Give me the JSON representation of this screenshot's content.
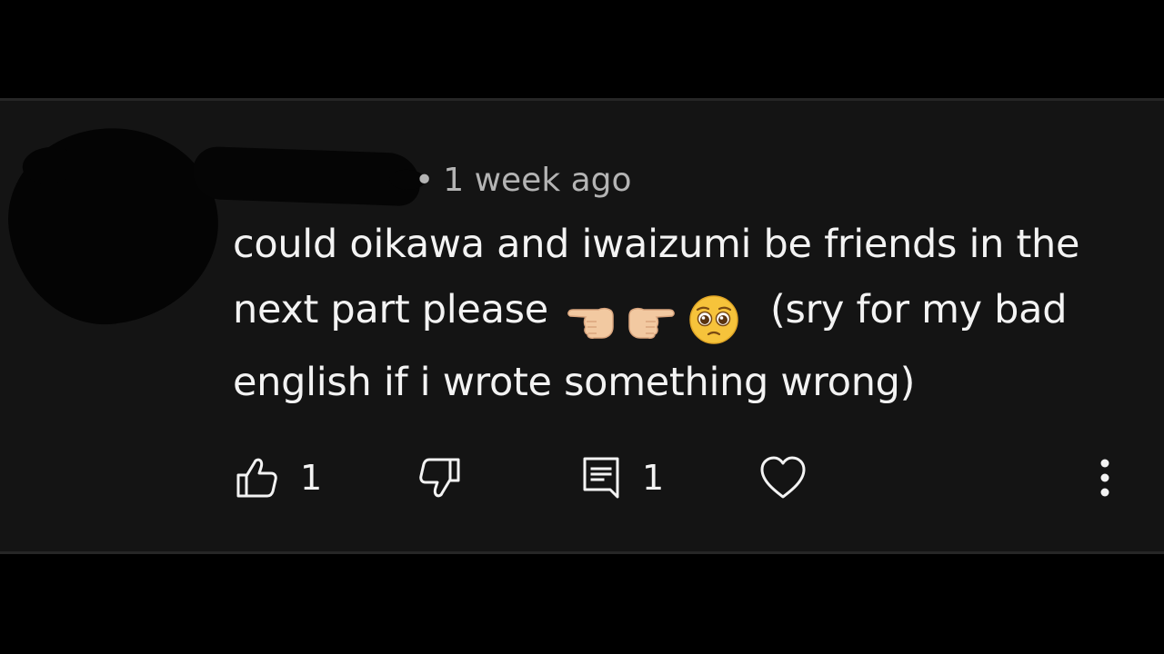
{
  "comment": {
    "timestamp": "1 week ago",
    "separator": "•",
    "text_before_emoji": "could oikawa and iwaizumi be friends in the next part please",
    "emoji": [
      "backhand-index-pointing-left",
      "backhand-index-pointing-right",
      "pleading-face"
    ],
    "text_after_emoji": "(sry for my bad english if i wrote something wrong)"
  },
  "actions": {
    "like_count": "1",
    "reply_count": "1"
  },
  "colors": {
    "card_background": "#141414",
    "page_background": "#000000",
    "text": "#f3f3f3",
    "meta_text": "#b4b4b4"
  }
}
